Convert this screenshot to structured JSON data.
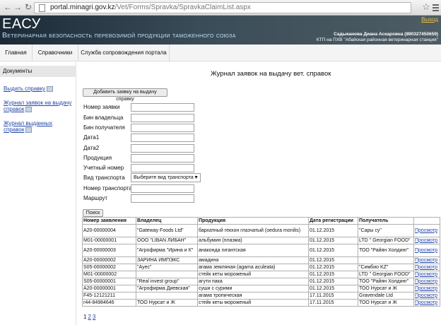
{
  "browser": {
    "url_host": "portal.minagri.gov.kz",
    "url_path": "/Vet/Forms/Spravka/SpravkaClaimList.aspx"
  },
  "header": {
    "logo": "ЕАСУ",
    "subtitle": "Ветеринарная безопасность перевозимой продукции таможенного союза",
    "logout": "Выход",
    "user_name": "Садыканова Диана Аскаровна (890327450659)",
    "user_org": "КТП на ПХВ \"Абайская районная ветеринарная станция\""
  },
  "topmenu": [
    "Главная",
    "Справочники",
    "Служба сопровождения портала"
  ],
  "sidebar": {
    "heading": "Документы",
    "links": [
      "Выдать справку",
      "Журнал заявок на выдачу справок",
      "Журнал выданных справок"
    ]
  },
  "main": {
    "title": "Журнал заявок на выдачу вет. справок",
    "add_button": "Добавить заявку на выдачу справку",
    "search_button": "Поиск"
  },
  "filters": {
    "claim_number": "Номер заявки",
    "owner_bin": "Бин владельца",
    "receiver_bin": "Бин получателя",
    "date1": "Дата1",
    "date2": "Дата2",
    "product": "Продукция",
    "account_number": "Учетный номер",
    "transport_type": "Вид транспорта",
    "transport_placeholder": "Выберите вид транспорта",
    "transport_number": "Номер транспорта",
    "route": "Маршрут"
  },
  "table": {
    "columns": [
      "Номер заявления",
      "Владелец",
      "Продукция",
      "Дата регистрации",
      "Получатель",
      ""
    ],
    "rows": [
      {
        "num": "A20-00000004",
        "owner": "\"Gateway Foods Ltd\"",
        "product": "бархатный гекхон глазчатый (oedura monilis)",
        "date": "01.12.2015",
        "receiver": "\"Сары су\"",
        "link": "Просмотр"
      },
      {
        "num": "M01-00000001",
        "owner": "ООО \"LIBAN ЛИБАН\"",
        "product": "альбумин (плазма)",
        "date": "01.12.2015",
        "receiver": "LTD \" Georgian FOOD\"",
        "link": "Просмотр"
      },
      {
        "num": "A20-00000003",
        "owner": "\"Агрофирма \"Ирина и К\"",
        "product": "анаконда гигантская",
        "date": "01.12.2015",
        "receiver": "ТОО \"Райян Холдинг\"",
        "link": "Просмотр"
      },
      {
        "num": "A20-00000002",
        "owner": "ЗАРИНА ИМПЭКС",
        "product": "амадина",
        "date": "01.12.2015",
        "receiver": "",
        "link": "Просмотр"
      },
      {
        "num": "S05-00000002",
        "owner": "\"Аyec\"",
        "product": "агама земляная (agama aculeata)",
        "date": "01.12.2015",
        "receiver": "\"Симбио KZ\"",
        "link": "Просмотр"
      },
      {
        "num": "M01-00000002",
        "owner": "",
        "product": "стейк кеты мороженый",
        "date": "01.12.2015",
        "receiver": "LTD \" Georgian FOOD\"",
        "link": "Просмотр"
      },
      {
        "num": "S05-00000001",
        "owner": "\"Real invest group\"",
        "product": "агути пака",
        "date": "01.12.2015",
        "receiver": "ТОО \"Райян Холдинг\"",
        "link": "Просмотр"
      },
      {
        "num": "A20-00000001",
        "owner": "\"Агрофирма Диевская\"",
        "product": "суши с сурими",
        "date": "01.12.2015",
        "receiver": "ТОО Нурсат и Ж",
        "link": "Просмотр"
      },
      {
        "num": "F45-12121211",
        "owner": "",
        "product": "агама тропическая",
        "date": "17.11.2015",
        "receiver": "Gravendale Ltd",
        "link": "Просмотр"
      },
      {
        "num": "r44-84984646",
        "owner": "ТОО Нурсат и Ж",
        "product": "стейк кеты мороженый",
        "date": "17.11.2015",
        "receiver": "ТОО Нурсат и Ж",
        "link": "Просмотр"
      }
    ]
  },
  "pager": {
    "current": "1",
    "pages": [
      "2",
      "3"
    ]
  }
}
